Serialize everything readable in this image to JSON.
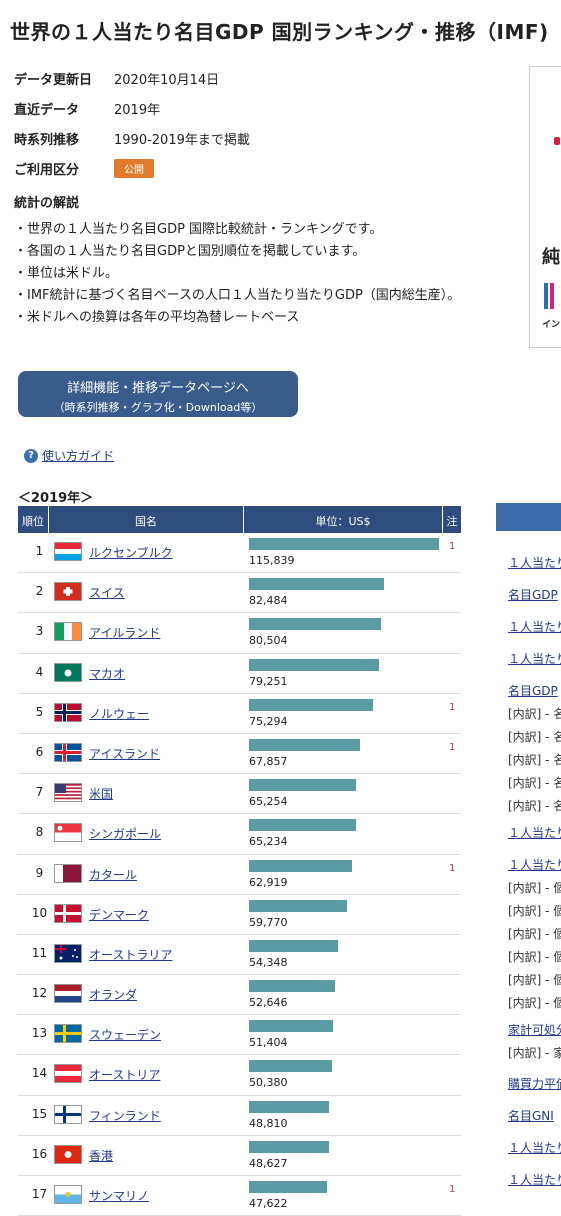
{
  "title": "世界の１人当たり名目GDP 国別ランキング・推移（IMF)",
  "meta": [
    {
      "key": "データ更新日",
      "value": "2020年10月14日"
    },
    {
      "key": "直近データ",
      "value": "2019年"
    },
    {
      "key": "時系列推移",
      "value": "1990-2019年まで掲載"
    },
    {
      "key": "ご利用区分",
      "value": "公開"
    }
  ],
  "commentary": {
    "heading": "統計の解説",
    "lines": [
      "・世界の１人当たり名目GDP 国際比較統計・ランキングです。",
      "・各国の１人当たり名目GDPと国別順位を掲載しています。",
      "・単位は米ドル。",
      "・IMF統計に基づく名目ベースの人口１人当たり当たりGDP（国内総生産）。",
      "・米ドルへの換算は各年の平均為替レートベース"
    ]
  },
  "ad": {
    "text1": "純",
    "text2": "イン"
  },
  "detail_button": {
    "line1": "詳細機能・推移データページへ",
    "line2": "（時系列推移・グラフ化・Download等）"
  },
  "guide_link": "使い方ガイド",
  "guide_icon": "?",
  "year_label": "＜2019年＞",
  "table": {
    "headers": {
      "rank": "順位",
      "country": "国名",
      "unit": "単位：US$",
      "note": "注"
    },
    "max_value": 115839,
    "rows": [
      {
        "rank": "1",
        "country": "ルクセンブルク",
        "value": 115839,
        "value_text": "115,839",
        "note": "1",
        "flag": "lu"
      },
      {
        "rank": "2",
        "country": "スイス",
        "value": 82484,
        "value_text": "82,484",
        "note": "",
        "flag": "ch"
      },
      {
        "rank": "3",
        "country": "アイルランド",
        "value": 80504,
        "value_text": "80,504",
        "note": "",
        "flag": "ie"
      },
      {
        "rank": "4",
        "country": "マカオ",
        "value": 79251,
        "value_text": "79,251",
        "note": "",
        "flag": "mo"
      },
      {
        "rank": "5",
        "country": "ノルウェー",
        "value": 75294,
        "value_text": "75,294",
        "note": "1",
        "flag": "no"
      },
      {
        "rank": "6",
        "country": "アイスランド",
        "value": 67857,
        "value_text": "67,857",
        "note": "1",
        "flag": "is"
      },
      {
        "rank": "7",
        "country": "米国",
        "value": 65254,
        "value_text": "65,254",
        "note": "",
        "flag": "us"
      },
      {
        "rank": "8",
        "country": "シンガポール",
        "value": 65234,
        "value_text": "65,234",
        "note": "",
        "flag": "sg"
      },
      {
        "rank": "9",
        "country": "カタール",
        "value": 62919,
        "value_text": "62,919",
        "note": "1",
        "flag": "qa"
      },
      {
        "rank": "10",
        "country": "デンマーク",
        "value": 59770,
        "value_text": "59,770",
        "note": "",
        "flag": "dk"
      },
      {
        "rank": "11",
        "country": "オーストラリア",
        "value": 54348,
        "value_text": "54,348",
        "note": "",
        "flag": "au"
      },
      {
        "rank": "12",
        "country": "オランダ",
        "value": 52646,
        "value_text": "52,646",
        "note": "",
        "flag": "nl"
      },
      {
        "rank": "13",
        "country": "スウェーデン",
        "value": 51404,
        "value_text": "51,404",
        "note": "",
        "flag": "se"
      },
      {
        "rank": "14",
        "country": "オーストリア",
        "value": 50380,
        "value_text": "50,380",
        "note": "",
        "flag": "at"
      },
      {
        "rank": "15",
        "country": "フィンランド",
        "value": 48810,
        "value_text": "48,810",
        "note": "",
        "flag": "fi"
      },
      {
        "rank": "16",
        "country": "香港",
        "value": 48627,
        "value_text": "48,627",
        "note": "",
        "flag": "hk"
      },
      {
        "rank": "17",
        "country": "サンマリノ",
        "value": 47622,
        "value_text": "47,622",
        "note": "1",
        "flag": "sm"
      }
    ]
  },
  "sidebar": {
    "items": [
      {
        "text": "１人当たり",
        "kind": "link"
      },
      {
        "text": "名目GDP",
        "kind": "link"
      },
      {
        "text": "１人当たり",
        "kind": "link"
      },
      {
        "text": "１人当たり",
        "kind": "link"
      },
      {
        "text": "名目GDP",
        "kind": "link"
      },
      {
        "text": "[内訳] - 名",
        "kind": "sub"
      },
      {
        "text": "[内訳] - 名",
        "kind": "sub"
      },
      {
        "text": "[内訳] - 名",
        "kind": "sub"
      },
      {
        "text": "[内訳] - 名",
        "kind": "sub"
      },
      {
        "text": "[内訳] - 名",
        "kind": "sub"
      },
      {
        "text": "１人当たり",
        "kind": "link"
      },
      {
        "text": "１人当たり",
        "kind": "link"
      },
      {
        "text": "[内訳] - 個",
        "kind": "sub"
      },
      {
        "text": "[内訳] - 個",
        "kind": "sub"
      },
      {
        "text": "[内訳] - 個",
        "kind": "sub"
      },
      {
        "text": "[内訳] - 個",
        "kind": "sub"
      },
      {
        "text": "[内訳] - 個",
        "kind": "sub"
      },
      {
        "text": "[内訳] - 個",
        "kind": "sub"
      },
      {
        "text": "家計可処分",
        "kind": "link"
      },
      {
        "text": "[内訳] - 家",
        "kind": "sub"
      },
      {
        "text": "購買力平価",
        "kind": "link"
      },
      {
        "text": "名目GNI",
        "kind": "link"
      },
      {
        "text": "１人当たり",
        "kind": "link"
      },
      {
        "text": "１人当たり",
        "kind": "link"
      }
    ]
  },
  "colors": {
    "header_bg": "#2f4c7e",
    "bar": "#5b9ba3",
    "button_bg": "#3a5c8c",
    "badge": "#e07a2c",
    "link": "#223a8c"
  }
}
